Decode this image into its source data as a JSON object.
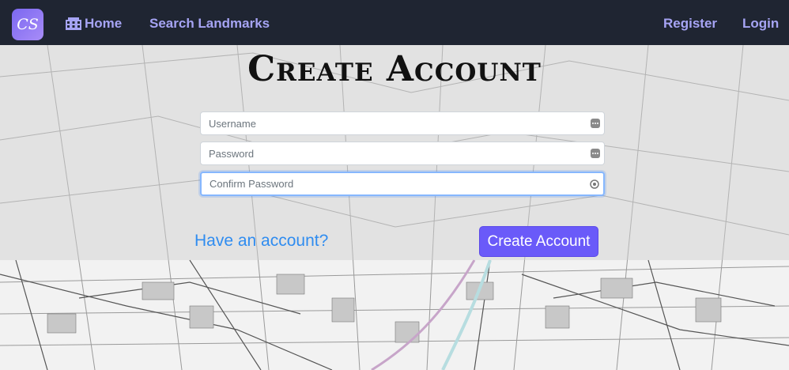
{
  "nav": {
    "logo_text": "CS",
    "home_label": "Home",
    "search_label": "Search Landmarks",
    "register_label": "Register",
    "login_label": "Login",
    "link_color": "#a6a4f4",
    "bg_color": "#1f2532"
  },
  "page": {
    "title": "Create Account"
  },
  "form": {
    "username_placeholder": "Username",
    "password_placeholder": "Password",
    "confirm_placeholder": "Confirm Password",
    "have_account_label": "Have an account?",
    "submit_label": "Create Account",
    "submit_color": "#6a5af9"
  }
}
